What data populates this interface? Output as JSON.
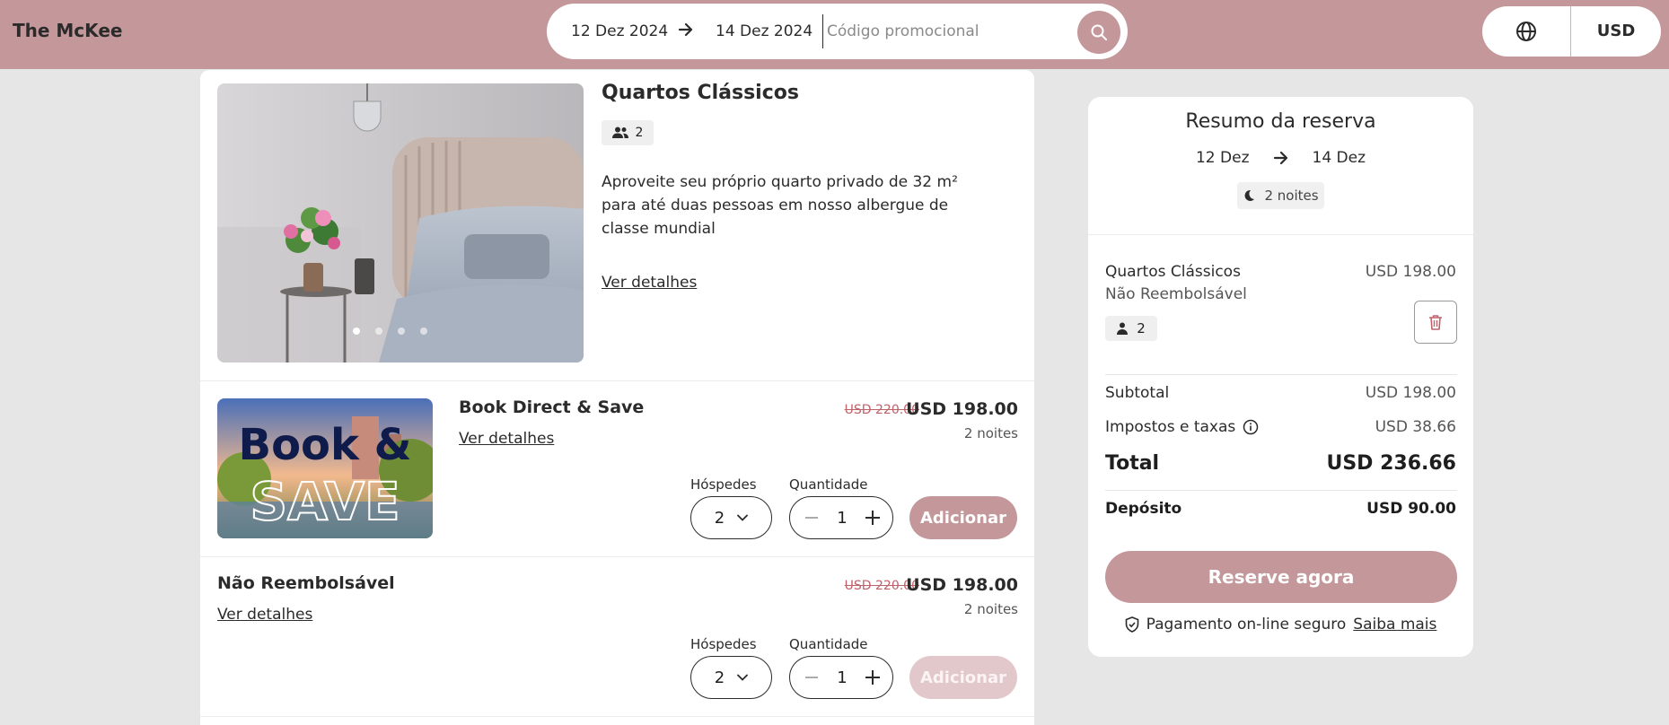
{
  "header": {
    "brand": "The McKee",
    "check_in": "12 Dez 2024",
    "check_out": "14 Dez 2024",
    "promo_placeholder": "Código promocional",
    "currency": "USD"
  },
  "room": {
    "title": "Quartos Clássicos",
    "guests": "2",
    "description": "Aproveite seu próprio quarto privado de 32 m² para até duas pessoas em nosso albergue de classe mundial",
    "details_link": "Ver detalhes",
    "carousel_dots": 4
  },
  "rates": [
    {
      "title": "Book Direct & Save",
      "details_link": "Ver detalhes",
      "old_price": "USD 220.00",
      "price": "USD 198.00",
      "nights": "2 noites",
      "guests_label": "Hóspedes",
      "guests_value": "2",
      "qty_label": "Quantidade",
      "qty_value": "1",
      "add_label": "Adicionar",
      "image_text_1": "Book &",
      "image_text_2": "SAVE"
    },
    {
      "title": "Não Reembolsável",
      "details_link": "Ver detalhes",
      "old_price": "USD 220.00",
      "price": "USD 198.00",
      "nights": "2 noites",
      "guests_label": "Hóspedes",
      "guests_value": "2",
      "qty_label": "Quantidade",
      "qty_value": "1",
      "add_label": "Adicionar"
    }
  ],
  "summary": {
    "title": "Resumo da reserva",
    "from": "12 Dez",
    "to": "14 Dez",
    "nights": "2 noites",
    "item_name": "Quartos Clássicos",
    "item_rate": "Não Reembolsável",
    "item_price": "USD 198.00",
    "item_guests": "2",
    "subtotal_label": "Subtotal",
    "subtotal_value": "USD 198.00",
    "taxes_label": "Impostos e taxas",
    "taxes_value": "USD 38.66",
    "total_label": "Total",
    "total_value": "USD 236.66",
    "deposit_label": "Depósito",
    "deposit_value": "USD 90.00",
    "book_label": "Reserve agora",
    "secure_text": "Pagamento on-line seguro",
    "learn_more": "Saiba mais"
  },
  "colors": {
    "accent": "#c4979a",
    "accent_disabled": "#e2c8ca",
    "strike_price": "#c0626b",
    "background": "#e6e6e6"
  }
}
